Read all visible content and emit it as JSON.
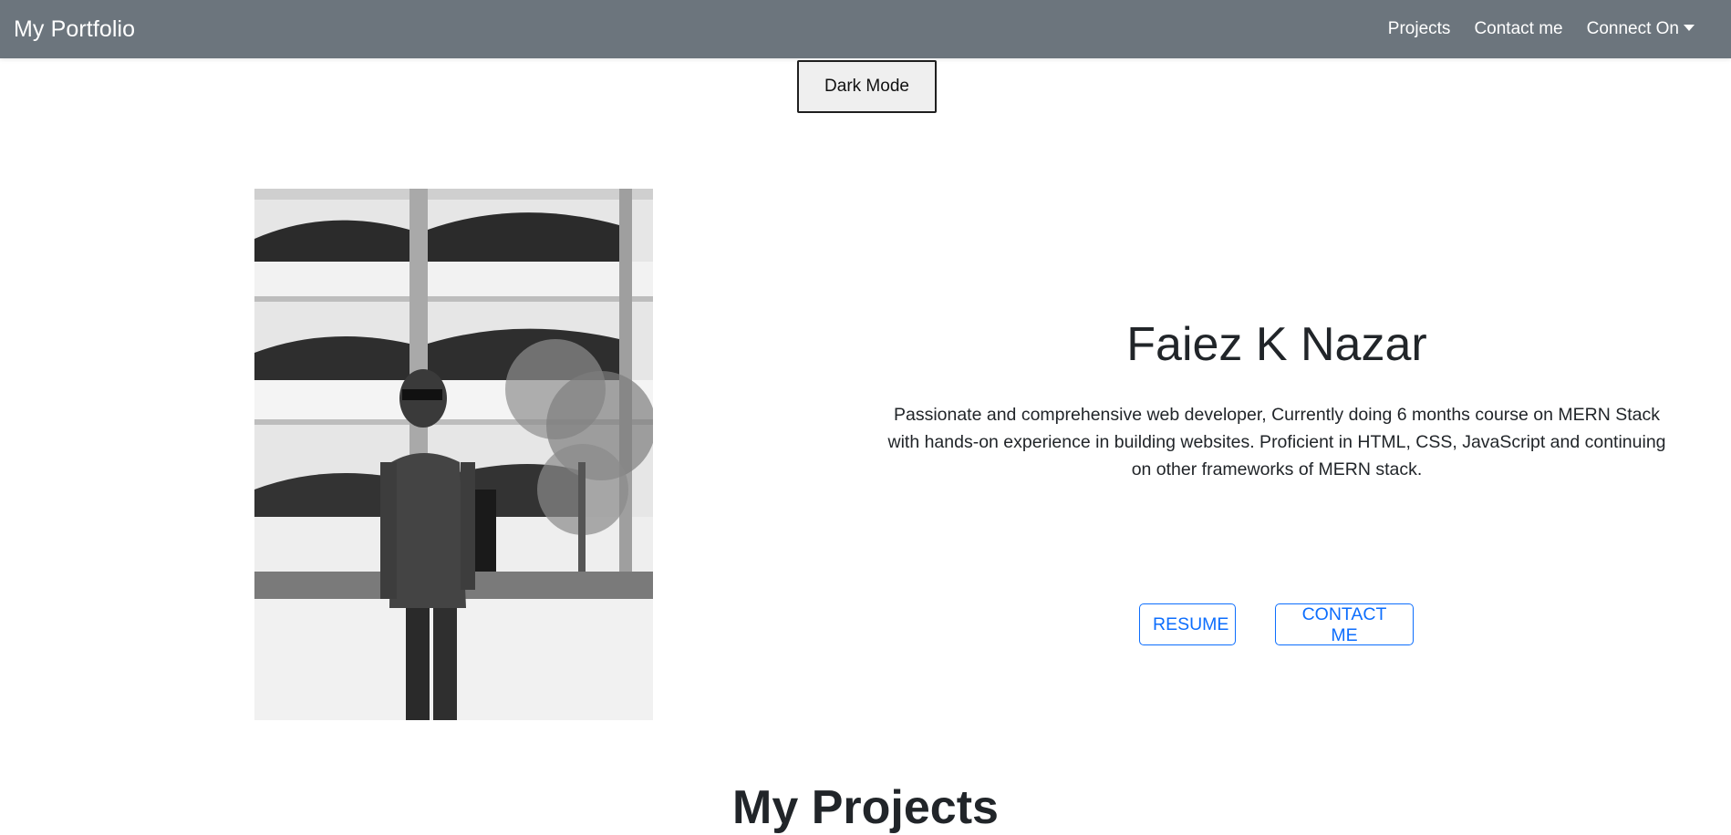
{
  "navbar": {
    "brand": "My Portfolio",
    "links": [
      {
        "label": "Projects"
      },
      {
        "label": "Contact me"
      },
      {
        "label": "Connect On"
      }
    ]
  },
  "dark_mode_button": "Dark Mode",
  "hero": {
    "name": "Faiez K Nazar",
    "bio": "Passionate and comprehensive web developer, Currently doing 6 months course on MERN Stack with hands-on experience in building websites. Proficient in HTML, CSS, JavaScript and continuing on other frameworks of MERN stack.",
    "resume_button": "RESUME",
    "contact_button": "CONTACT ME"
  },
  "next_section_title": "My Projects",
  "colors": {
    "navbar_bg": "#6c757d",
    "primary": "#0d6efd"
  }
}
